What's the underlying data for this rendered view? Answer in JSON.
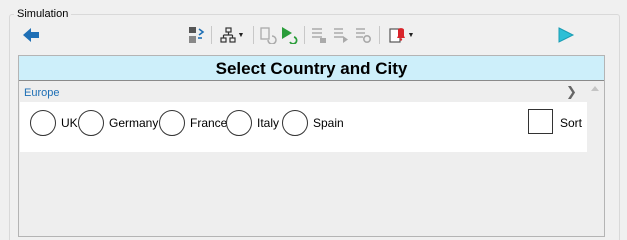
{
  "group": {
    "title": "Simulation"
  },
  "toolbar": {
    "back_icon": "back-arrow-icon",
    "items": [
      {
        "name": "swap-icon"
      },
      {
        "name": "tree-icon",
        "dropdown": true
      },
      {
        "name": "refresh-icon",
        "disabled": true
      },
      {
        "name": "run-refresh-icon"
      },
      {
        "name": "list-icon",
        "disabled": true
      },
      {
        "name": "list-forward-icon",
        "disabled": true
      },
      {
        "name": "list-settings-icon",
        "disabled": true
      },
      {
        "name": "alert-icon",
        "dropdown": true
      }
    ],
    "play_icon": "play-icon"
  },
  "panel": {
    "title": "Select Country and City",
    "region": "Europe",
    "options": [
      "UK",
      "Germany",
      "France",
      "Italy",
      "Spain"
    ],
    "sort_label": "Sort"
  },
  "colors": {
    "header_bg": "#cdeffa",
    "accent_blue": "#1e6fb5",
    "play_teal": "#2dbfd6",
    "run_green": "#2a9d3a",
    "alert_red": "#d9242a"
  }
}
